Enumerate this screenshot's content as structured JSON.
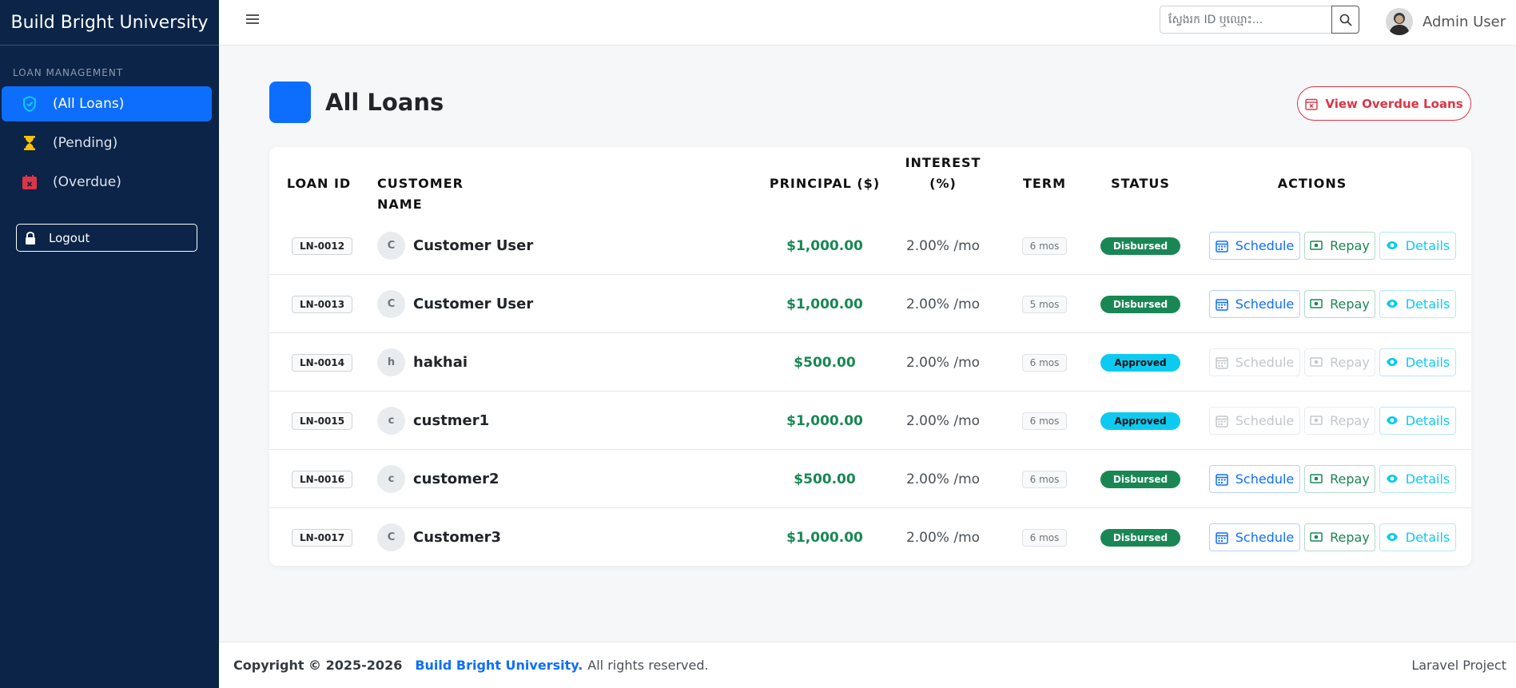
{
  "sidebar": {
    "brand": "Build Bright University",
    "section_label": "LOAN MANAGEMENT",
    "items": [
      {
        "label": "(All Loans)",
        "icon": "shield-icon",
        "color": "#0dcaf0"
      },
      {
        "label": "(Pending)",
        "icon": "hourglass-icon",
        "color": "#ffc107"
      },
      {
        "label": "(Overdue)",
        "icon": "calendar-x-icon",
        "color": "#dc3545"
      }
    ],
    "logout_label": "Logout"
  },
  "topbar": {
    "search_placeholder": "ស្វែងរក ID ឬឈ្មោះ...",
    "user_name": "Admin User"
  },
  "page": {
    "title": "All Loans",
    "overdue_button": "View Overdue Loans"
  },
  "table": {
    "headers": {
      "loan_id": "LOAN ID",
      "customer": "CUSTOMER NAME",
      "principal": "PRINCIPAL ($)",
      "interest_1": "INTEREST",
      "interest_2": "(%)",
      "term": "TERM",
      "status": "STATUS",
      "actions": "ACTIONS"
    },
    "action_labels": {
      "schedule": "Schedule",
      "repay": "Repay",
      "details": "Details"
    },
    "rows": [
      {
        "id": "LN-0012",
        "initial": "C",
        "name": "Customer User",
        "principal": "$1,000.00",
        "interest": "2.00% /mo",
        "term": "6 mos",
        "status": "Disbursed",
        "status_type": "disbursed",
        "actions_enabled": true
      },
      {
        "id": "LN-0013",
        "initial": "C",
        "name": "Customer User",
        "principal": "$1,000.00",
        "interest": "2.00% /mo",
        "term": "5 mos",
        "status": "Disbursed",
        "status_type": "disbursed",
        "actions_enabled": true
      },
      {
        "id": "LN-0014",
        "initial": "h",
        "name": "hakhai",
        "principal": "$500.00",
        "interest": "2.00% /mo",
        "term": "6 mos",
        "status": "Approved",
        "status_type": "approved",
        "actions_enabled": false
      },
      {
        "id": "LN-0015",
        "initial": "c",
        "name": "custmer1",
        "principal": "$1,000.00",
        "interest": "2.00% /mo",
        "term": "6 mos",
        "status": "Approved",
        "status_type": "approved",
        "actions_enabled": false
      },
      {
        "id": "LN-0016",
        "initial": "c",
        "name": "customer2",
        "principal": "$500.00",
        "interest": "2.00% /mo",
        "term": "6 mos",
        "status": "Disbursed",
        "status_type": "disbursed",
        "actions_enabled": true
      },
      {
        "id": "LN-0017",
        "initial": "C",
        "name": "Customer3",
        "principal": "$1,000.00",
        "interest": "2.00% /mo",
        "term": "6 mos",
        "status": "Disbursed",
        "status_type": "disbursed",
        "actions_enabled": true
      }
    ]
  },
  "footer": {
    "copyright": "Copyright © 2025-2026",
    "university": "Build Bright University.",
    "rights": "All rights reserved.",
    "project": "Laravel Project"
  }
}
